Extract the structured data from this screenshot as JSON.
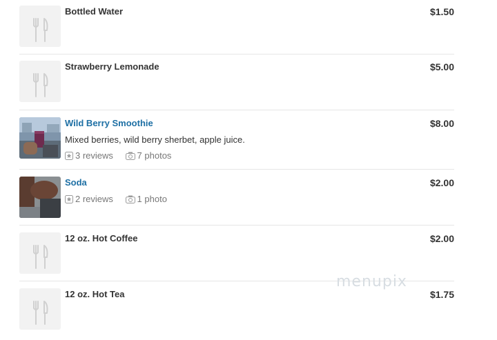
{
  "items": [
    {
      "name": "Bottled Water",
      "price": "$1.50"
    },
    {
      "name": "Strawberry Lemonade",
      "price": "$5.00"
    },
    {
      "name": "Wild Berry Smoothie",
      "price": "$8.00",
      "description": "Mixed berries, wild berry sherbet, apple juice.",
      "reviews": "3 reviews",
      "photos": "7 photos"
    },
    {
      "name": "Soda",
      "price": "$2.00",
      "reviews": "2 reviews",
      "photos": "1 photo"
    },
    {
      "name": "12 oz. Hot Coffee",
      "price": "$2.00"
    },
    {
      "name": "12 oz. Hot Tea",
      "price": "$1.75"
    }
  ],
  "watermark": "menupix",
  "icons": {
    "placeholder": "fork-knife-icon",
    "review": "star-icon",
    "photo": "camera-icon"
  },
  "colors": {
    "link": "#1d6fa4",
    "muted": "#777777",
    "divider": "#e6e6e6"
  }
}
